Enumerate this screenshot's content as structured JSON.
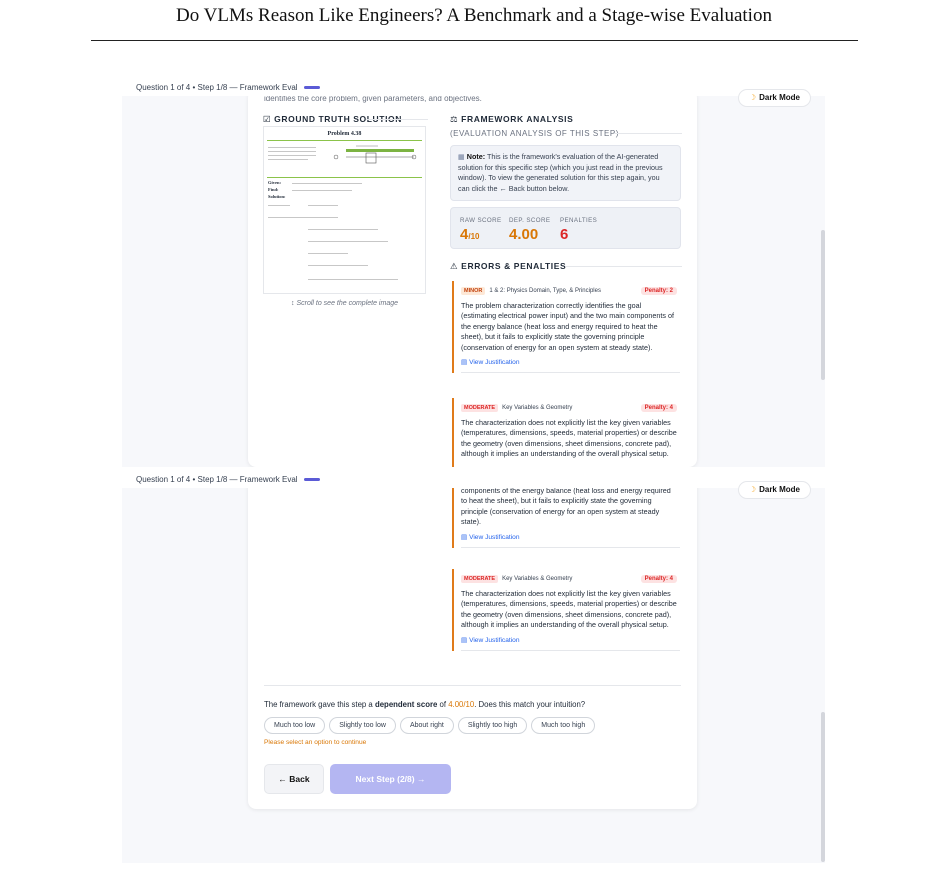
{
  "paper": {
    "title": "Do VLMs Reason Like Engineers? A Benchmark and a Stage-wise Evaluation"
  },
  "top_bar": {
    "progress_text": "Question 1 of 4 • Step 1/8 — Framework Eval",
    "dark_mode_label": "Dark Mode"
  },
  "intro_text": "identifies the core problem, given parameters, and objectives.",
  "ground_truth": {
    "heading": "☑ GROUND TRUTH SOLUTION",
    "problem_title": "Problem 4.38",
    "given_label": "Given:",
    "find_label": "Find:",
    "solution_label": "Solution:",
    "scroll_hint": "↕ Scroll to see the complete image"
  },
  "framework": {
    "heading": "⚖ FRAMEWORK ANALYSIS",
    "subheading": "(EVALUATION ANALYSIS OF THIS STEP)",
    "note_label": "Note:",
    "note_text": " This is the framework's evaluation of the AI-generated solution for this specific step (which you just read in the previous window). To view the generated solution for this step again, you can click the ← Back button below.",
    "raw_score_label": "RAW SCORE",
    "raw_score": "4",
    "raw_score_denom": "/10",
    "dep_score_label": "DEP. SCORE",
    "dep_score": "4.00",
    "penalties_label": "PENALTIES",
    "penalties": "6"
  },
  "errors_heading": "⚠ ERRORS & PENALTIES",
  "errors": [
    {
      "severity": "MINOR",
      "category": "1 & 2: Physics Domain, Type, & Principles",
      "penalty": "Penalty: 2",
      "text": "The problem characterization correctly identifies the goal (estimating electrical power input) and the two main components of the energy balance (heat loss and energy required to heat the sheet), but it fails to explicitly state the governing principle (conservation of energy for an open system at steady state).",
      "link": "View Justification"
    },
    {
      "severity": "MODERATE",
      "category": "Key Variables & Geometry",
      "penalty": "Penalty: 4",
      "text": "The characterization does not explicitly list the key given variables (temperatures, dimensions, speeds, material properties) or describe the geometry (oven dimensions, sheet dimensions, concrete pad), although it implies an understanding of the overall physical setup.",
      "link": "View Justification"
    }
  ],
  "bottom_partial_text": "components of the energy balance (heat loss and energy required to heat the sheet), but it fails to explicitly state the governing principle (conservation of energy for an open system at steady state).",
  "rating": {
    "question_pre": "The framework gave this step a ",
    "question_bold": "dependent score",
    "question_mid": " of ",
    "question_score": "4.00/10",
    "question_post": ". Does this match your intuition?",
    "options": [
      "Much too low",
      "Slightly too low",
      "About right",
      "Slightly too high",
      "Much too high"
    ],
    "warning": "Please select an option to continue",
    "back_label": "← Back",
    "next_label": "Next Step (2/8) →"
  },
  "colors": {
    "accent": "#5b5bd6",
    "score": "#d97706",
    "penalty": "#dc2626",
    "next_disabled": "#b4b6f2"
  }
}
